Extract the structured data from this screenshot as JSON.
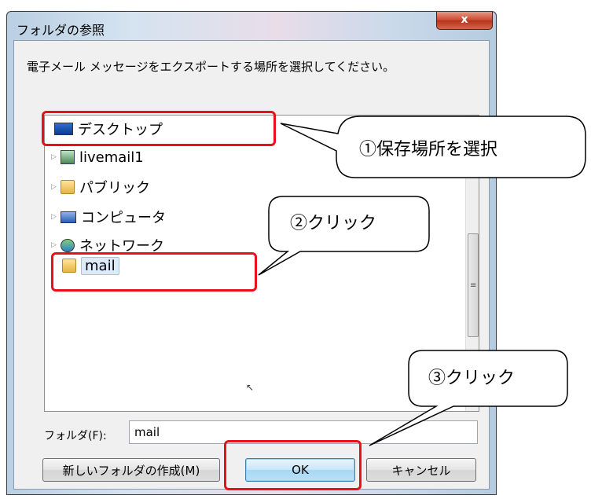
{
  "dialog": {
    "title": "フォルダの参照",
    "close_glyph": "x",
    "instruction": "電子メール メッセージをエクスポートする場所を選択してください。"
  },
  "tree": {
    "items": [
      {
        "label": "デスクトップ",
        "icon": "desktop-icon",
        "has_expander": false
      },
      {
        "label": "livemail1",
        "icon": "user-icon",
        "has_expander": true
      },
      {
        "label": "パブリック",
        "icon": "folder-icon",
        "has_expander": true
      },
      {
        "label": "コンピュータ",
        "icon": "computer-icon",
        "has_expander": true
      },
      {
        "label": "ネットワーク",
        "icon": "network-icon",
        "has_expander": true
      },
      {
        "label": "mail",
        "icon": "folder-icon",
        "has_expander": false,
        "selected": true
      }
    ]
  },
  "folder_field": {
    "label": "フォルダ(F):",
    "value": "mail"
  },
  "buttons": {
    "new_folder": "新しいフォルダの作成(M)",
    "ok": "OK",
    "cancel": "キャンセル"
  },
  "callouts": {
    "step1": "①保存場所を選択",
    "step2": "②クリック",
    "step3": "③クリック"
  },
  "colors": {
    "highlight": "#e8101b",
    "selection": "#dceaf9"
  }
}
